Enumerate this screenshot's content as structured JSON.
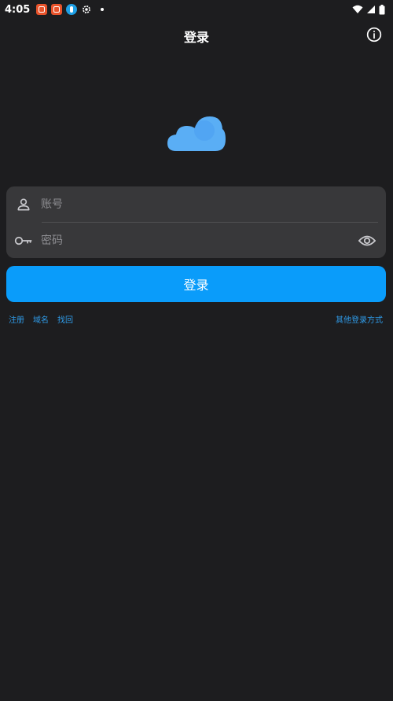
{
  "status_bar": {
    "time": "4:05"
  },
  "header": {
    "title": "登录"
  },
  "form": {
    "account_placeholder": "账号",
    "account_value": "",
    "password_placeholder": "密码",
    "password_value": ""
  },
  "login_button": "登录",
  "links": {
    "register": "注册",
    "domain": "域名",
    "recover": "找回",
    "other_login": "其他登录方式"
  },
  "colors": {
    "background": "#1d1d1f",
    "card": "#38383a",
    "accent": "#0a9cfa",
    "link": "#2f9be8",
    "logo": "#5aaef5"
  }
}
